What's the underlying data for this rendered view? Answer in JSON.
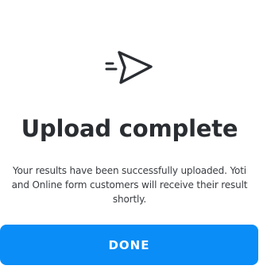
{
  "confirmation": {
    "icon": "paper-plane-icon",
    "title": "Upload complete",
    "message": "Your results have been successfully uploaded. Yoti and Online form customers will receive their result shortly.",
    "done_label": "DONE"
  },
  "colors": {
    "accent": "#0a8df6",
    "text": "#2a2d31",
    "background": "#ffffff"
  }
}
